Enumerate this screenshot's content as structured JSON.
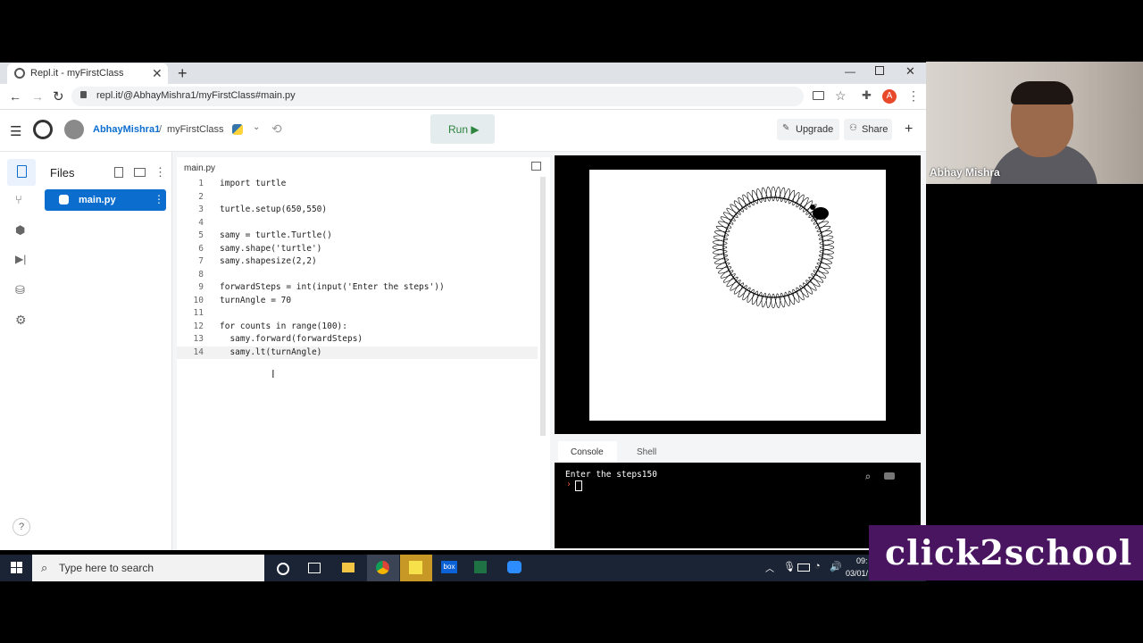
{
  "browser": {
    "tab_title": "Repl.it - myFirstClass",
    "new_tab": "+",
    "url": "repl.it/@AbhayMishra1/myFirstClass#main.py",
    "profile_initial": "A",
    "window_controls": [
      "minimize-icon",
      "restore-icon",
      "close-icon"
    ]
  },
  "repl_header": {
    "user": "AbhayMishra1",
    "separator": "/",
    "project": "myFirstClass",
    "run_label": "Run ▶",
    "upgrade_label": "Upgrade",
    "share_label": "Share",
    "plus": "+"
  },
  "files": {
    "title": "Files",
    "items": [
      {
        "label": "main.py",
        "selected": true
      }
    ]
  },
  "editor": {
    "tab": "main.py",
    "lines": [
      {
        "n": "1",
        "text": "import turtle"
      },
      {
        "n": "2",
        "text": ""
      },
      {
        "n": "3",
        "text": "turtle.setup(650,550)"
      },
      {
        "n": "4",
        "text": ""
      },
      {
        "n": "5",
        "text": "samy = turtle.Turtle()"
      },
      {
        "n": "6",
        "text": "samy.shape('turtle')"
      },
      {
        "n": "7",
        "text": "samy.shapesize(2,2)"
      },
      {
        "n": "8",
        "text": ""
      },
      {
        "n": "9",
        "text": "forwardSteps = int(input('Enter the steps'))"
      },
      {
        "n": "10",
        "text": "turnAngle = 70"
      },
      {
        "n": "11",
        "text": ""
      },
      {
        "n": "12",
        "text": "for counts in range(100):"
      },
      {
        "n": "13",
        "text": "  samy.forward(forwardSteps)"
      },
      {
        "n": "14",
        "text": "  samy.lt(turnAngle)"
      }
    ]
  },
  "console": {
    "tabs": [
      "Console",
      "Shell"
    ],
    "output": "Enter the steps150",
    "prompt": "›"
  },
  "taskbar": {
    "search_placeholder": "Type here to search",
    "time": "09:",
    "date": "03/01/"
  },
  "webcam": {
    "name": "Abhay Mishra"
  },
  "logo": {
    "text": "click2school"
  },
  "colors": {
    "replit_blue": "#0079f2",
    "run_green": "#2e8540",
    "keyword": "#8b3fa6",
    "string": "#b5402b",
    "number": "#2e7d32"
  }
}
